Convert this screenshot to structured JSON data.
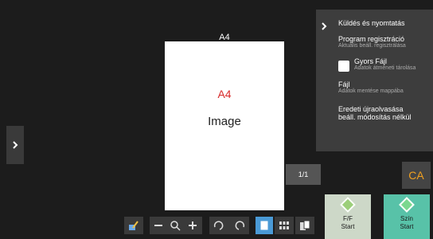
{
  "document": {
    "top_label": "A4",
    "page_label": "A4",
    "page_text": "Image"
  },
  "pager": {
    "text": "1/1"
  },
  "panel": {
    "title": "Küldés és nyomtatás",
    "items": [
      {
        "heading": "Program regisztráció",
        "sub": "Aktuális beáll. regisztrálása"
      },
      {
        "heading": "Gyors Fájl",
        "sub": "Adatok átmeneti tárolása"
      },
      {
        "heading": "Fájl",
        "sub": "Adatok mentése mappába"
      },
      {
        "heading": "Eredeti újraolvasása",
        "heading2": "beáll. módosítás nélkül"
      }
    ]
  },
  "ca": {
    "label": "CA"
  },
  "start_ff": {
    "line1": "F/F",
    "line2": "Start"
  },
  "start_szin": {
    "line1": "Szín",
    "line2": "Start"
  },
  "colors": {
    "ca_text": "#f0a020",
    "page_accent": "#d82a2a",
    "start_color": "#58c2a8",
    "start_bw": "#cdd8c8"
  }
}
